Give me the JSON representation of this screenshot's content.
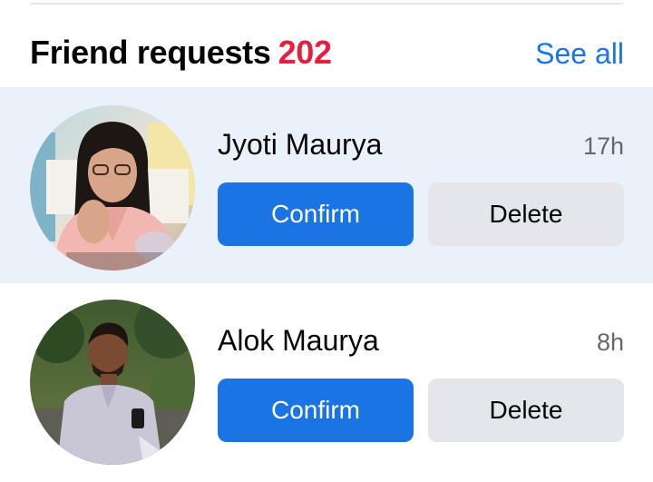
{
  "header": {
    "title": "Friend requests",
    "count": "202",
    "see_all": "See all"
  },
  "requests": [
    {
      "name": "Jyoti Maurya",
      "time": "17h",
      "confirm_label": "Confirm",
      "delete_label": "Delete"
    },
    {
      "name": "Alok Maurya",
      "time": "8h",
      "confirm_label": "Confirm",
      "delete_label": "Delete"
    }
  ],
  "colors": {
    "accent": "#1b74e4",
    "count_red": "#e41e3f",
    "highlight_row": "#e9f1fb",
    "delete_bg": "#e4e6eb"
  }
}
